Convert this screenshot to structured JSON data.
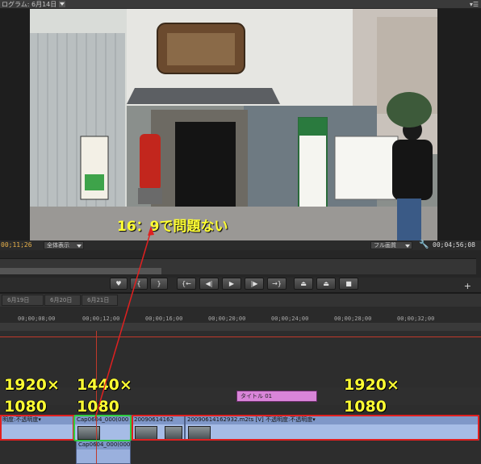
{
  "monitor": {
    "title": "ログラム: 6月14日",
    "timecode_current": "00;11;26",
    "fit_label": "全体表示",
    "quality_label": "フル画質",
    "timecode_duration": "00;04;56;08"
  },
  "video": {
    "caption": "16：9で問題ない"
  },
  "transport": {
    "buttons": [
      "marker",
      "in",
      "out",
      "go-to-in",
      "step-back",
      "play",
      "step-forward",
      "go-to-out",
      "lift",
      "extract",
      "export-frame"
    ]
  },
  "timeline": {
    "tabs": [
      "6月19日",
      "6月20日",
      "6月21日"
    ],
    "ruler_labels": [
      "00;00;08;00",
      "00;00;12;00",
      "00;00;16;00",
      "00;00;20;00",
      "00;00;24;00",
      "00;00;28;00",
      "00;00;32;00"
    ],
    "title_clip": "タイトル 01",
    "clips": [
      {
        "label": "明度:不透明度▾"
      },
      {
        "label": "Cap0604_000(000"
      },
      {
        "label": "20090614162"
      },
      {
        "label": "20090614162932.m2ts [V]  不透明度:不透明度▾"
      }
    ],
    "clip_below_label": "Cap0604_000(000"
  },
  "annotations": {
    "left": {
      "line1": "1920×",
      "line2": "1080"
    },
    "middle": {
      "line1": "1440×",
      "line2": "1080"
    },
    "right": {
      "line1": "1920×",
      "line2": "1080"
    }
  },
  "colors": {
    "accent_yellow": "#ffff33",
    "box_red": "#e02020",
    "box_green": "#2ecc40",
    "clip_blue": "#8aa4d6",
    "title_pink": "#d985d9"
  }
}
